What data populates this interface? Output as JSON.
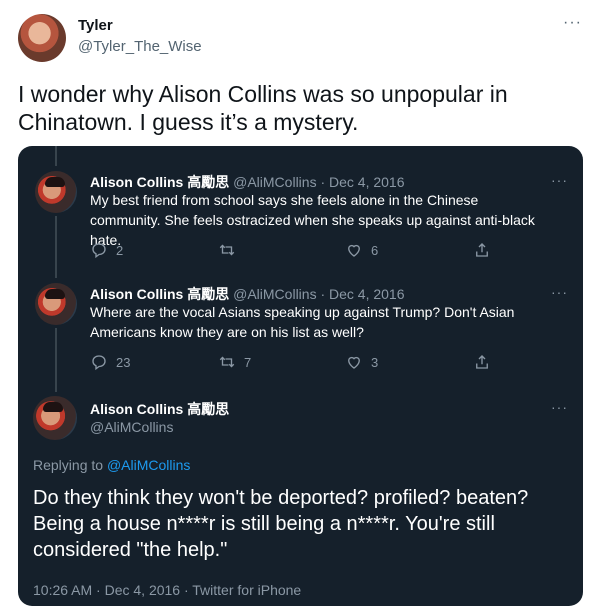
{
  "outer": {
    "name": "Tyler",
    "handle": "@Tyler_The_Wise",
    "more": "···",
    "text": "I wonder why Alison Collins was so unpopular in Chinatown. I guess it’s a mystery."
  },
  "thread": [
    {
      "name": "Alison Collins 高勵思",
      "handle_date": "@AliMCollins · Dec 4, 2016",
      "text": "My best friend from school says she feels alone in the Chinese community. She feels ostracized when she speaks up against anti-black hate.",
      "replies": "2",
      "retweets": "",
      "likes": "6"
    },
    {
      "name": "Alison Collins 高勵思",
      "handle_date": "@AliMCollins · Dec 4, 2016",
      "text": "Where are the vocal Asians speaking up against Trump? Don't Asian Americans know they are on his list as well?",
      "replies": "23",
      "retweets": "7",
      "likes": "3"
    }
  ],
  "main": {
    "name": "Alison Collins 高勵思",
    "handle": "@AliMCollins",
    "replying_prefix": "Replying to ",
    "replying_to": "@AliMCollins",
    "text": "Do they think they won't be deported? profiled? beaten? Being a house n****r is still being a n****r. You're still considered \"the help.\"",
    "meta": "10:26 AM · Dec 4, 2016 · Twitter for iPhone"
  },
  "more": "···",
  "icons": [
    "reply-icon",
    "retweet-icon",
    "like-icon",
    "share-icon",
    "more-icon"
  ]
}
